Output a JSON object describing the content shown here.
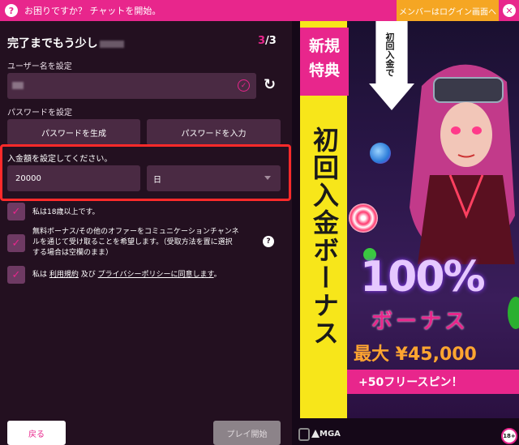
{
  "topbar": {
    "help_text": "お困りですか？ チャットを開始。",
    "login_label": "メンバーはログイン画面へ",
    "help_icon": "question-circle-icon",
    "close_icon": "close-circle-icon"
  },
  "form": {
    "heading": "完了までもう少し",
    "step_current": "3",
    "step_separator": "/",
    "step_total": "3",
    "username_label": "ユーザー名を設定",
    "password_label": "パスワードを設定",
    "generate_password": "パスワードを生成",
    "enter_password": "パスワードを入力",
    "deposit_label": "入金額を設定してください。",
    "deposit_amount": "20000",
    "deposit_period": "日",
    "checkbox_age": "私は18歳以上です。",
    "checkbox_offers_line1": "無料ボーナス/その他のオファーをコミュニケーションチャンネ",
    "checkbox_offers_line2": "ルを通じて受け取ることを希望します。（受取方法を置に選択",
    "checkbox_offers_line3": "する場合は空欄のまま）",
    "checkbox_terms_prefix": "私は",
    "checkbox_terms_link1": "利用規約",
    "checkbox_terms_and": "及び",
    "checkbox_terms_link2": "プライバシーポリシーに同意します",
    "checkbox_terms_suffix": "。",
    "back_label": "戻る",
    "play_label": "プレイ開始",
    "accent_color": "#e8268c"
  },
  "promo": {
    "badge_line1": "新規",
    "badge_line2": "特典",
    "vertical_title": "初回入金ボーナス",
    "arrow_text": "初回入金で",
    "percent": "100%",
    "bonus_word": "ボーナス",
    "max_text": "最大 ¥45,000",
    "free_spins": "+50フリースピン！",
    "mga_label": "MGA",
    "age_badge": "18+"
  }
}
